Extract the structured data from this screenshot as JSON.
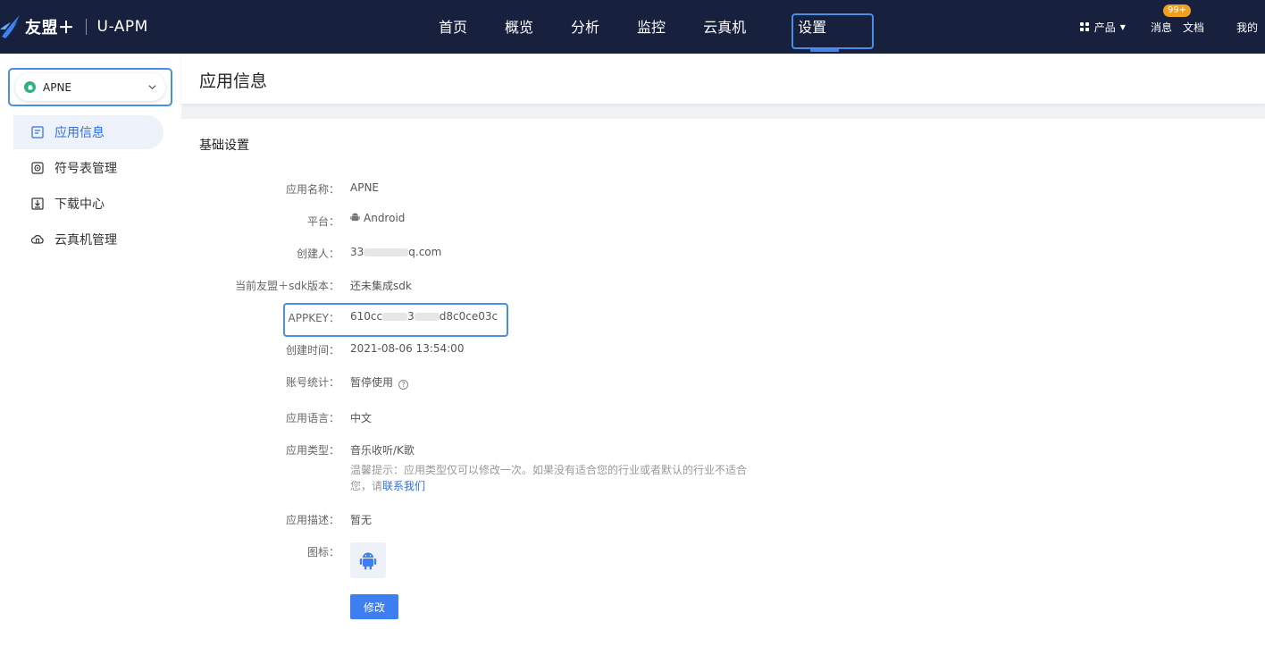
{
  "brand": {
    "name": "友盟＋",
    "product": "U-APM"
  },
  "nav": {
    "items": [
      "首页",
      "概览",
      "分析",
      "监控",
      "云真机",
      "设置"
    ],
    "active_index": 5
  },
  "topright": {
    "product_label": "产品",
    "messages_label": "消息",
    "messages_badge": "99+",
    "docs_label": "文档",
    "mine_label": "我的"
  },
  "sidebar": {
    "app_select": {
      "value": "APNE"
    },
    "items": [
      {
        "label": "应用信息",
        "icon": "app-info-icon",
        "active": true
      },
      {
        "label": "符号表管理",
        "icon": "symbol-table-icon",
        "active": false
      },
      {
        "label": "下载中心",
        "icon": "download-icon",
        "active": false
      },
      {
        "label": "云真机管理",
        "icon": "cloud-device-icon",
        "active": false
      }
    ]
  },
  "page": {
    "title": "应用信息",
    "section_title": "基础设置"
  },
  "fields": {
    "name": {
      "label": "应用名称：",
      "value": "APNE"
    },
    "platform": {
      "label": "平台：",
      "value": "Android"
    },
    "creator": {
      "label": "创建人：",
      "value_prefix": "33",
      "value_suffix": "q.com"
    },
    "sdk": {
      "label": "当前友盟＋sdk版本：",
      "value": "还未集成sdk"
    },
    "appkey": {
      "label": "APPKEY：",
      "value_part1": "610cc",
      "value_part2": "3",
      "value_part3": "d8c0ce03c"
    },
    "created": {
      "label": "创建时间：",
      "value": "2021-08-06 13:54:00"
    },
    "account": {
      "label": "账号统计：",
      "value": "暂停使用"
    },
    "language": {
      "label": "应用语言：",
      "value": "中文"
    },
    "type": {
      "label": "应用类型：",
      "value": "音乐收听/K歌",
      "hint": "温馨提示：应用类型仅可以修改一次。如果没有适合您的行业或者默认的行业不适合您，请",
      "hint_link": "联系我们"
    },
    "desc": {
      "label": "应用描述：",
      "value": "暂无"
    },
    "icon": {
      "label": "图标："
    }
  },
  "actions": {
    "edit_label": "修改"
  },
  "colors": {
    "topbar": "#17203d",
    "accent": "#3d7ef0",
    "highlight": "#4a8ee8"
  }
}
